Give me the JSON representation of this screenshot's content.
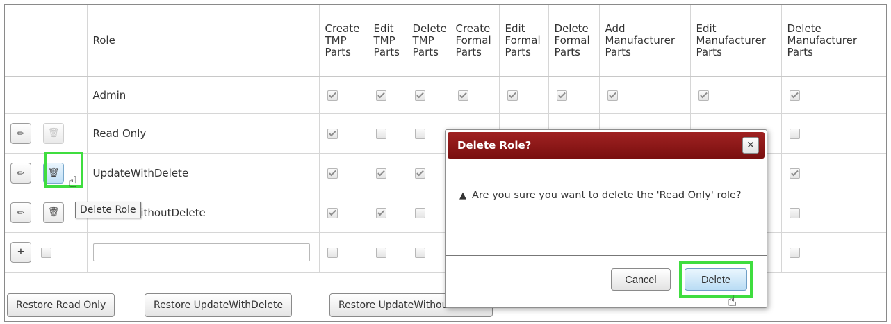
{
  "table": {
    "columns": [
      {
        "key": "actions",
        "label": ""
      },
      {
        "key": "role",
        "label": "Role"
      },
      {
        "key": "create_tmp",
        "label": "Create\nTMP\nParts"
      },
      {
        "key": "edit_tmp",
        "label": "Edit\nTMP\nParts"
      },
      {
        "key": "delete_tmp",
        "label": "Delete\nTMP\nParts"
      },
      {
        "key": "create_formal",
        "label": "Create\nFormal\nParts"
      },
      {
        "key": "edit_formal",
        "label": "Edit\nFormal\nParts"
      },
      {
        "key": "delete_formal",
        "label": "Delete\nFormal\nParts"
      },
      {
        "key": "add_mfr",
        "label": "Add\nManufacturer\nParts"
      },
      {
        "key": "edit_mfr",
        "label": "Edit\nManufacturer\nParts"
      },
      {
        "key": "delete_mfr",
        "label": "Delete\nManufacturer\nParts"
      }
    ],
    "rows": [
      {
        "name": "Admin",
        "editable": false,
        "perms": [
          true,
          true,
          true,
          true,
          true,
          true,
          true,
          true,
          true
        ]
      },
      {
        "name": "Read Only",
        "editable": true,
        "perms": [
          true,
          false,
          false,
          false,
          false,
          false,
          false,
          false,
          false
        ]
      },
      {
        "name": "UpdateWithDelete",
        "editable": true,
        "perms": [
          true,
          true,
          true,
          false,
          false,
          false,
          false,
          false,
          true
        ]
      },
      {
        "name": "UpdateWithoutDelete",
        "editable": true,
        "perms": [
          true,
          true,
          false,
          false,
          false,
          false,
          false,
          false,
          false
        ]
      }
    ],
    "new_row": {
      "add_label": "+"
    }
  },
  "tooltip": {
    "text": "Delete Role"
  },
  "restore_buttons": [
    "Restore Read Only",
    "Restore UpdateWithDelete",
    "Restore UpdateWithoutDelete"
  ],
  "dialog": {
    "title": "Delete Role?",
    "close_label": "✕",
    "message": "Are you sure you want to delete the 'Read Only' role?",
    "cancel_label": "Cancel",
    "delete_label": "Delete"
  },
  "colors": {
    "dialog_title": "#8b1a1a",
    "highlight": "#3fdd3f"
  }
}
